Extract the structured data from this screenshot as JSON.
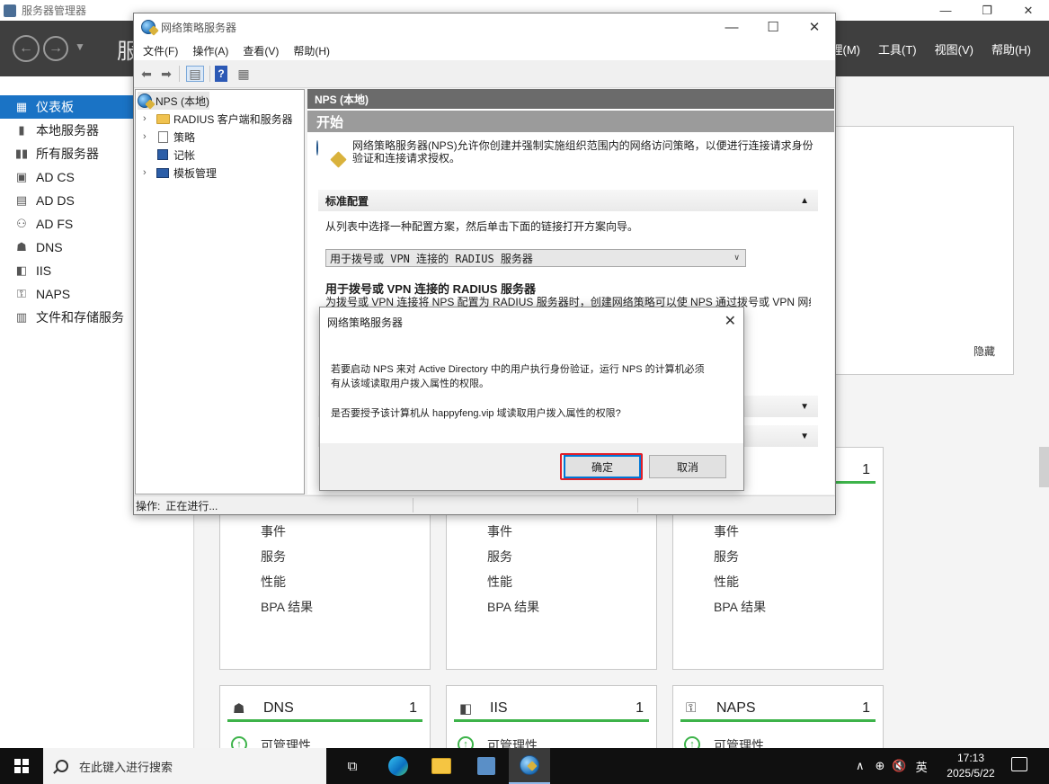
{
  "server_manager": {
    "window_title": "服务器管理器",
    "title_partial": "服",
    "menu": [
      "管理(M)",
      "工具(T)",
      "视图(V)",
      "帮助(H)"
    ],
    "sidebar": [
      {
        "label": "仪表板",
        "icon": "dashboard-icon",
        "active": true
      },
      {
        "label": "本地服务器",
        "icon": "server-icon"
      },
      {
        "label": "所有服务器",
        "icon": "servers-icon"
      },
      {
        "label": "AD CS",
        "icon": "adcs-icon"
      },
      {
        "label": "AD DS",
        "icon": "adds-icon"
      },
      {
        "label": "AD FS",
        "icon": "adfs-icon"
      },
      {
        "label": "DNS",
        "icon": "dns-icon"
      },
      {
        "label": "IIS",
        "icon": "iis-icon"
      },
      {
        "label": "NAPS",
        "icon": "naps-icon"
      },
      {
        "label": "文件和存储服务",
        "icon": "storage-icon"
      }
    ],
    "hide_label": "隐藏",
    "tile_lines": [
      "事件",
      "服务",
      "性能",
      "BPA 结果"
    ],
    "top_tile_count": "1",
    "bottom_tiles": [
      {
        "name": "DNS",
        "count": "1",
        "status": "可管理性",
        "icon": "dns-icon"
      },
      {
        "name": "IIS",
        "count": "1",
        "status": "可管理性",
        "icon": "iis-icon"
      },
      {
        "name": "NAPS",
        "count": "1",
        "status": "可管理性",
        "icon": "naps-icon"
      }
    ]
  },
  "nps": {
    "window_title": "网络策略服务器",
    "menu": [
      "文件(F)",
      "操作(A)",
      "查看(V)",
      "帮助(H)"
    ],
    "tree": [
      {
        "label": "NPS (本地)",
        "icon": "globe-icon",
        "selected": true
      },
      {
        "label": "RADIUS 客户端和服务器",
        "icon": "folder-icon"
      },
      {
        "label": "策略",
        "icon": "policy-icon"
      },
      {
        "label": "记帐",
        "icon": "accounting-icon"
      },
      {
        "label": "模板管理",
        "icon": "template-icon"
      }
    ],
    "content_header": "NPS (本地)",
    "start_header": "开始",
    "intro": "网络策略服务器(NPS)允许你创建并强制实施组织范围内的网络访问策略，以便进行连接请求身份验证和连接请求授权。",
    "standard_config": {
      "heading": "标准配置",
      "desc": "从列表中选择一种配置方案，然后单击下面的链接打开方案向导。",
      "selected_option": "用于拨号或 VPN 连接的 RADIUS 服务器",
      "subtitle": "用于拨号或 VPN 连接的 RADIUS 服务器",
      "text": "为拨号或 VPN 连接将 NPS 配置为 RADIUS 服务器时，创建网络策略可以使 NPS 通过拨号或 VPN 网络"
    },
    "status_label": "操作:",
    "status_value": "正在进行..."
  },
  "dialog": {
    "title": "网络策略服务器",
    "message_line1": "若要启动 NPS 来对 Active Directory 中的用户执行身份验证，运行 NPS 的计算机必须",
    "message_line2": "有从该域读取用户拨入属性的权限。",
    "question": "是否要授予该计算机从 happyfeng.vip 域读取用户拨入属性的权限?",
    "ok": "确定",
    "cancel": "取消"
  },
  "taskbar": {
    "search_placeholder": "在此键入进行搜索",
    "ime": "英",
    "time": "17:13",
    "date": "2025/5/22"
  }
}
